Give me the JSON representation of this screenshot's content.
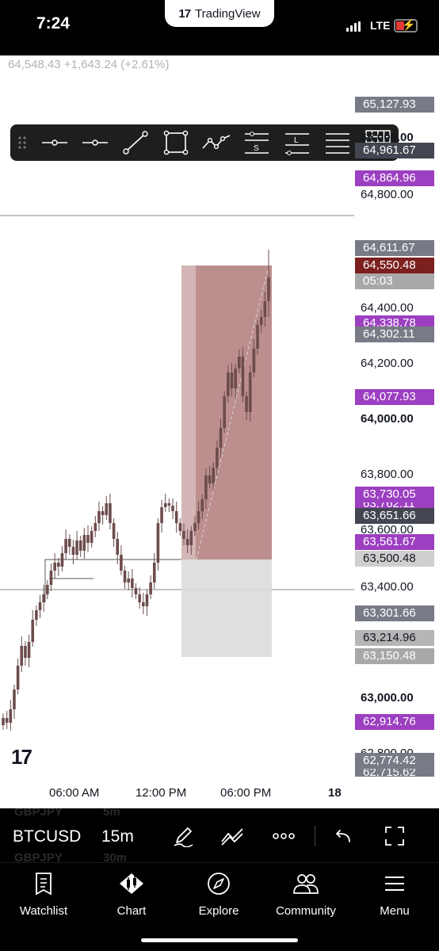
{
  "status_bar": {
    "time": "7:24",
    "app_pill": "TradingView",
    "app_pill_logo": "17",
    "network": "LTE",
    "battery_state": "low-charging"
  },
  "chart": {
    "price_summary": "64,548.43 +1,643.24 (+2.61%)",
    "watermark": "17",
    "price_scale": {
      "labels": [
        {
          "text": "65,000.00",
          "bold": true
        },
        {
          "text": "64,800.00",
          "bold": false
        },
        {
          "text": "64,400.00",
          "bold": false
        },
        {
          "text": "64,200.00",
          "bold": false
        },
        {
          "text": "64,000.00",
          "bold": true
        },
        {
          "text": "63,800.00",
          "bold": false
        },
        {
          "text": "63,600.00",
          "bold": false
        },
        {
          "text": "63,400.00",
          "bold": false
        },
        {
          "text": "63,000.00",
          "bold": true
        },
        {
          "text": "62,800.00",
          "bold": false
        }
      ],
      "tags": [
        {
          "text": "65,127.93",
          "color": "#787b86"
        },
        {
          "text": "64,961.67",
          "color": "#434651"
        },
        {
          "text": "64,864.96",
          "color": "#9c3fc1"
        },
        {
          "text": "64,611.67",
          "color": "#787b86"
        },
        {
          "text": "64,550.48",
          "color": "#7b1f1f"
        },
        {
          "text": "05:03",
          "color": "#a8a8a8"
        },
        {
          "text": "64,338.78",
          "color": "#9c3fc1"
        },
        {
          "text": "64,302.11",
          "color": "#787b86"
        },
        {
          "text": "64,077.93",
          "color": "#9c3fc1"
        },
        {
          "text": "63,762.11",
          "color": "#9c3fc1"
        },
        {
          "text": "63,730.05",
          "color": "#9c3fc1"
        },
        {
          "text": "63,651.66",
          "color": "#434651"
        },
        {
          "text": "63,561.67",
          "color": "#9c3fc1"
        },
        {
          "text": "63,500.48",
          "color": "#cfcfcf"
        },
        {
          "text": "63,301.66",
          "color": "#787b86"
        },
        {
          "text": "63,214.96",
          "color": "#b6b6b6"
        },
        {
          "text": "63,150.48",
          "color": "#a8a8a8"
        },
        {
          "text": "62,914.76",
          "color": "#9c3fc1"
        },
        {
          "text": "62,774.42",
          "color": "#787b86"
        },
        {
          "text": "62,715.62",
          "color": "#787b86"
        }
      ]
    },
    "time_axis": [
      "06:00 AM",
      "12:00 PM",
      "06:00 PM",
      "18"
    ],
    "colors": {
      "candle": "#6d4c4c",
      "short_position_zone": "#b07a7a",
      "profit_zone": "#dcdcdc",
      "horizontal_line": "#8a8a8a"
    }
  },
  "drawing_toolbar": {
    "tools": [
      "drag-handle-icon",
      "horizontal-line-icon",
      "horizontal-ray-icon",
      "trend-line-icon",
      "rectangle-icon",
      "path-icon",
      "s-lines-icon",
      "l-lines-icon",
      "parallel-lines-icon",
      "grid-icon"
    ]
  },
  "symbol_bar": {
    "symbol": "BTCUSD",
    "interval": "15m",
    "ghost_rows": [
      {
        "symbol": "GBPJPY",
        "interval": "5m"
      },
      {
        "symbol": "GBPJPY",
        "interval": "30m"
      }
    ]
  },
  "bottom_nav": {
    "items": [
      {
        "label": "Watchlist",
        "icon": "watchlist-icon"
      },
      {
        "label": "Chart",
        "icon": "chart-icon"
      },
      {
        "label": "Explore",
        "icon": "compass-icon"
      },
      {
        "label": "Community",
        "icon": "people-icon"
      },
      {
        "label": "Menu",
        "icon": "hamburger-icon"
      }
    ]
  }
}
